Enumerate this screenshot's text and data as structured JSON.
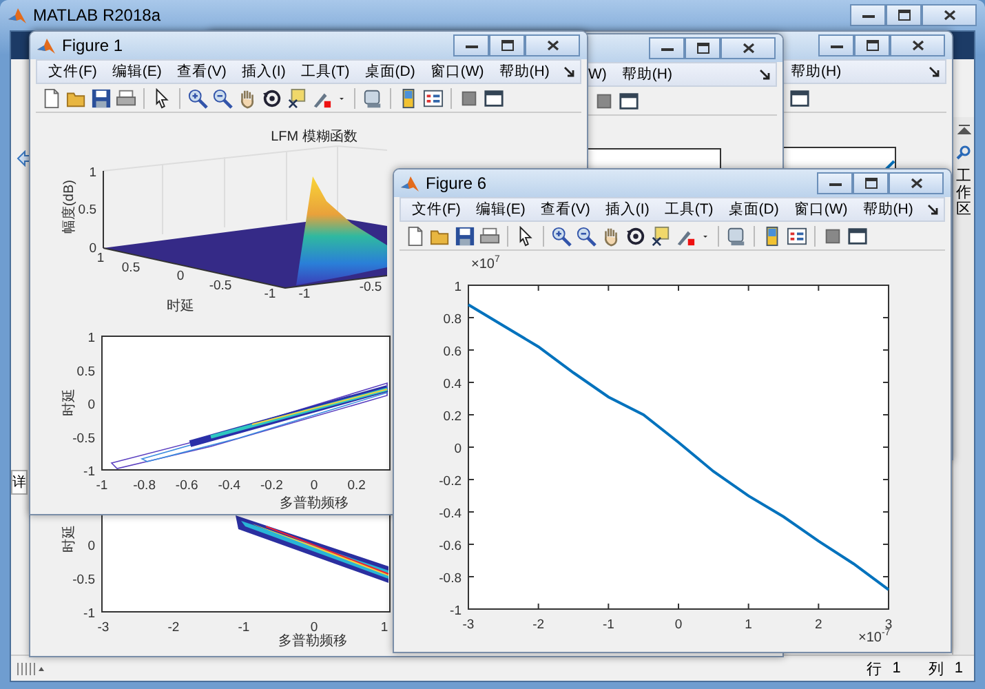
{
  "main_window": {
    "title": "MATLAB R2018a",
    "left_tab": "详",
    "side_panel": "工作区",
    "status_bar": [
      {
        "label": "行",
        "value": "1"
      },
      {
        "label": "列",
        "value": "1"
      }
    ]
  },
  "background_windows": [
    {
      "menu": [
        "帮助(H)"
      ]
    },
    {
      "menu": [
        "W)",
        "帮助(H)"
      ],
      "lower_plot": {
        "yticks": [
          "0",
          "-0.5",
          "-1"
        ],
        "ylabel": "时延",
        "xticks": [
          "-3",
          "-2",
          "-1",
          "0",
          "1"
        ],
        "xlabel": "多普勒频移"
      }
    }
  ],
  "figure_1": {
    "title": "Figure 1",
    "menu": [
      "文件(F)",
      "编辑(E)",
      "查看(V)",
      "插入(I)",
      "工具(T)",
      "桌面(D)",
      "窗口(W)",
      "帮助(H)"
    ],
    "surface_plot": {
      "title": "LFM 模糊函数",
      "zlabel": "幅度(dB)",
      "zticks": [
        "1",
        "0.5",
        "0"
      ],
      "depth_ticks": [
        "1",
        "0.5",
        "0",
        "-0.5",
        "-1"
      ],
      "depth_label": "时延",
      "width_ticks": [
        "-1",
        "-0.5"
      ]
    },
    "contour_plot": {
      "yticks": [
        "1",
        "0.5",
        "0",
        "-0.5",
        "-1"
      ],
      "ylabel": "时延",
      "xticks": [
        "-1",
        "-0.8",
        "-0.6",
        "-0.4",
        "-0.2",
        "0",
        "0.2"
      ],
      "xlabel": "多普勒频移"
    }
  },
  "figure_6": {
    "title": "Figure 6",
    "menu": [
      "文件(F)",
      "编辑(E)",
      "查看(V)",
      "插入(I)",
      "工具(T)",
      "桌面(D)",
      "窗口(W)",
      "帮助(H)"
    ],
    "plot": {
      "y_multiplier": "×10$^{7}$",
      "x_multiplier": "×10$^{-7}$",
      "chart_data": {
        "type": "line",
        "x": [
          -3,
          -2.5,
          -2,
          -1.5,
          -1,
          -0.5,
          0,
          0.5,
          1,
          1.5,
          2,
          2.5,
          3
        ],
        "series": [
          {
            "color": "#0072bd",
            "values": [
              0.88,
              0.75,
              0.62,
              0.46,
              0.31,
              0.2,
              0.03,
              -0.15,
              -0.3,
              -0.43,
              -0.58,
              -0.72,
              -0.88
            ]
          }
        ],
        "xlim": [
          -3,
          3
        ],
        "ylim": [
          -1,
          1
        ],
        "xticks": [
          -3,
          -2,
          -1,
          0,
          1,
          2,
          3
        ],
        "yticks": [
          -1,
          -0.8,
          -0.6,
          -0.4,
          -0.2,
          0,
          0.2,
          0.4,
          0.6,
          0.8,
          1
        ]
      }
    }
  }
}
